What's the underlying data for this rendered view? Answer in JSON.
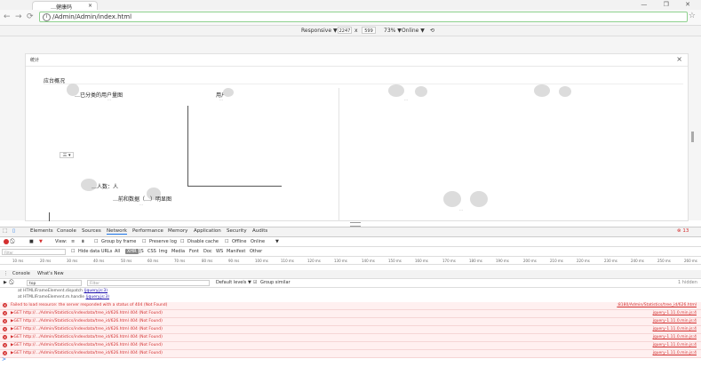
{
  "tab": {
    "title": "…健康码",
    "close": "×"
  },
  "window_controls": "— ❐ ✕",
  "nav": {
    "back": "←",
    "forward": "→",
    "reload": "⟳"
  },
  "address": {
    "url": "/Admin/Admin/index.html",
    "star": "☆"
  },
  "device_toolbar": {
    "mode": "Responsive ▼",
    "width": "2247",
    "times": "x",
    "height": "599",
    "zoom": "73% ▼",
    "network": "Online ▼",
    "rotate": "⟲"
  },
  "panel": {
    "title": "统计",
    "close": "×",
    "heading": "应台概况",
    "chart1_title": "…已分类的用户量图",
    "chart1_sub": "…",
    "label_user": "用户",
    "label_user_sub": "…",
    "dropdown": "三 ▾",
    "section2_title": "…人数：人",
    "chart2_title": "…前和数据（…）明显图",
    "chart2_sub": "…",
    "right_sub": "…"
  },
  "devtools": {
    "tabs": [
      "Elements",
      "Console",
      "Sources",
      "Network",
      "Performance",
      "Memory",
      "Application",
      "Security",
      "Audits"
    ],
    "active_tab": "Network",
    "error_badge": "⊗ 13",
    "network_bar": {
      "view": "View:",
      "group": "Group by frame",
      "preserve": "Preserve log",
      "disable_cache": "Disable cache",
      "offline": "Offline",
      "online": "Online",
      "online_caret": "▼"
    },
    "filter_placeholder": "Filter",
    "filter_options": [
      "Hide data URLs",
      "All",
      "XHR",
      "JS",
      "CSS",
      "Img",
      "Media",
      "Font",
      "Doc",
      "WS",
      "Manifest",
      "Other"
    ],
    "selected_filter": "XHR",
    "ruler": [
      "10 ms",
      "20 ms",
      "30 ms",
      "40 ms",
      "50 ms",
      "60 ms",
      "70 ms",
      "80 ms",
      "90 ms",
      "100 ms",
      "110 ms",
      "120 ms",
      "130 ms",
      "140 ms",
      "150 ms",
      "160 ms",
      "170 ms",
      "180 ms",
      "190 ms",
      "200 ms",
      "210 ms",
      "220 ms",
      "230 ms",
      "240 ms",
      "250 ms",
      "260 ms"
    ],
    "console_tabs": [
      "Console",
      "What's New"
    ],
    "console_bar": {
      "context": "top",
      "filter_placeholder": "Filter",
      "levels": "Default levels ▼",
      "group_similar": "Group similar",
      "hidden": "1 hidden"
    },
    "stack": [
      {
        "text": "at HTMLIFrameElement.dispatch",
        "link": "(jquery.js:3)"
      },
      {
        "text": "at HTMLIFrameElement.m.handle",
        "link": "(jquery.js:3)"
      }
    ],
    "errors": [
      {
        "msg": "Failed to load resource: the server responded with a status of 404 (Not Found)",
        "src": ":8180/Admin/Statistics/tree_id/626.html"
      },
      {
        "msg": "▶GET http://…/Admin/Statistics/indexdata/tree_id/626.html 404 (Not Found)",
        "src": "jquery-1.11.0.min.js:4"
      },
      {
        "msg": "▶GET http://…/Admin/Statistics/indexdata/tree_id/626.html 404 (Not Found)",
        "src": "jquery-1.11.0.min.js:4"
      },
      {
        "msg": "▶GET http://…/Admin/Statistics/indexdata/tree_id/626.html 404 (Not Found)",
        "src": "jquery-1.11.0.min.js:4"
      },
      {
        "msg": "▶GET http://…/Admin/Statistics/indexdata/tree_id/626.html 404 (Not Found)",
        "src": "jquery-1.11.0.min.js:4"
      },
      {
        "msg": "▶GET http://…/Admin/Statistics/indexdata/tree_id/626.html 404 (Not Found)",
        "src": "jquery-1.11.0.min.js:4"
      },
      {
        "msg": "▶GET http://…/Admin/Statistics/indexdata/tree_id/626.html 404 (Not Found)",
        "src": "jquery-1.11.0.min.js:4"
      }
    ],
    "prompt": ">"
  }
}
